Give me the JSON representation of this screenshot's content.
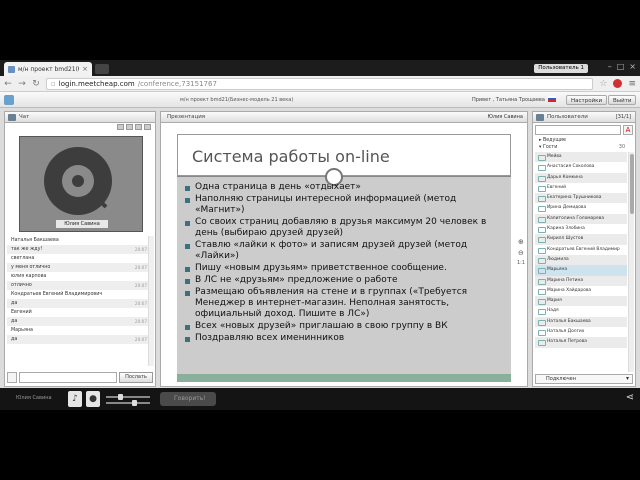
{
  "browser": {
    "tab_title": "м/н проект bmd21(бо",
    "user_badge": "Пользователь 1",
    "url_host": "login.meetcheap.com",
    "url_path": "/conference,73151767"
  },
  "app": {
    "room_title": "м/н проект bmd21(Бизнес-модель 21 века)",
    "greeting": "Привет , Татьяна Трощаева",
    "settings_label": "Настройки",
    "exit_label": "Выйти"
  },
  "chat": {
    "title": "Чат",
    "video_label": "Юлия Савина",
    "messages": [
      {
        "text": "Наталья Бакшаева",
        "time": "",
        "gray": false
      },
      {
        "text": "так же жду!",
        "time": "20:07",
        "gray": true
      },
      {
        "text": "светлана",
        "time": "",
        "gray": false
      },
      {
        "text": "у меня отлично",
        "time": "20:07",
        "gray": true
      },
      {
        "text": "юлия карпова",
        "time": "",
        "gray": false
      },
      {
        "text": "отлично",
        "time": "20:07",
        "gray": true
      },
      {
        "text": "Кондратьев Евгений Владимирович",
        "time": "",
        "gray": false
      },
      {
        "text": "да",
        "time": "20:07",
        "gray": true
      },
      {
        "text": "Евгений",
        "time": "",
        "gray": false
      },
      {
        "text": "да",
        "time": "20:07",
        "gray": true
      },
      {
        "text": "Марьяна",
        "time": "",
        "gray": false
      },
      {
        "text": "да",
        "time": "20:07",
        "gray": true
      }
    ],
    "send_label": "Послать"
  },
  "presentation": {
    "header": "Презентация",
    "presenter": "Юлия Савина",
    "slide_title": "Система работы on-line",
    "bullets": [
      "Одна страница в день «отдыхает»",
      "Наполняю страницы интересной информацией (метод «Магнит»)",
      "Со своих страниц добавляю в друзья максимум 20 человек в день (выбираю друзей друзей)",
      "Ставлю «лайки к фото» и записям друзей друзей (метод «Лайки»)",
      "Пишу «новым друзьям» приветственное сообщение.",
      "В ЛС не «друзьям» предложение о работе",
      "Размещаю объявления на стене и в группах («Требуется Менеджер в интернет-магазин. Неполная занятость, официальный доход. Пишите в ЛС»)",
      "Всех «новых друзей» приглашаю в свою группу в ВК",
      "Поздравляю всех именинников"
    ],
    "zoom_level": "1:1"
  },
  "users": {
    "title": "Пользователи",
    "count": "[31/1]",
    "group_leaders": "Ведущие",
    "group_guests": "Гости",
    "guests_count": "30",
    "list": [
      "Мейва",
      "Анастасия Соколова",
      "Дарья Комкина",
      "Евгений",
      "Екатерина Трушникова",
      "Ирина Демидова",
      "Капитолина Голомарева",
      "Карина Злобина",
      "Кирилл Шустов",
      "Кондратьев Евгений Владимир",
      "Людмила",
      "Марьяна",
      "Марина Петина",
      "Марина Хайдарова",
      "Мария",
      "Надя",
      "Наталья Бакшаева",
      "Наталья Долгих",
      "Наталья Петрова"
    ],
    "selected_index": 11,
    "status": "Подключен"
  },
  "bottombar": {
    "username": "Юлия Савина",
    "talk_label": "Говорить!"
  }
}
